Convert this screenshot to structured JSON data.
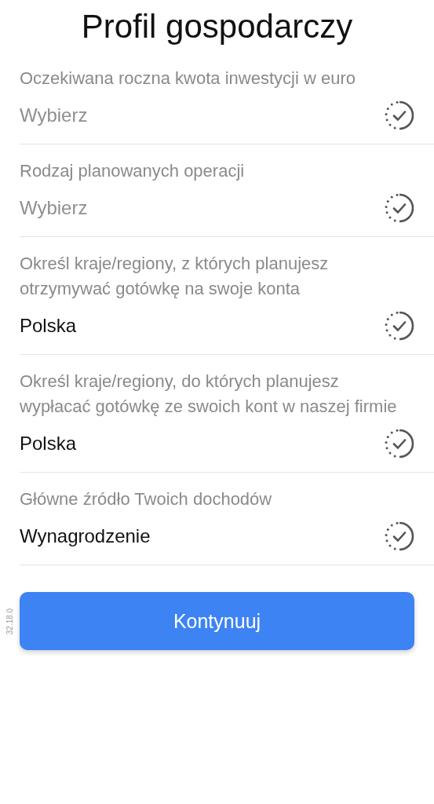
{
  "title": "Profil gospodarczy",
  "fields": [
    {
      "label": "Oczekiwana roczna kwota inwestycji w euro",
      "placeholder": "Wybierz"
    },
    {
      "label": "Rodzaj planowanych operacji",
      "placeholder": "Wybierz"
    },
    {
      "label": "Określ kraje/regiony, z których planujesz otrzymywać gotówkę na swoje konta",
      "value": "Polska"
    },
    {
      "label": "Określ kraje/regiony, do których planujesz wypłacać gotówkę ze swoich kont w naszej firmie",
      "value": "Polska"
    },
    {
      "label": "Główne źródło Twoich dochodów",
      "value": "Wynagrodzenie"
    }
  ],
  "version": "32.18.0",
  "button": "Kontynuuj"
}
